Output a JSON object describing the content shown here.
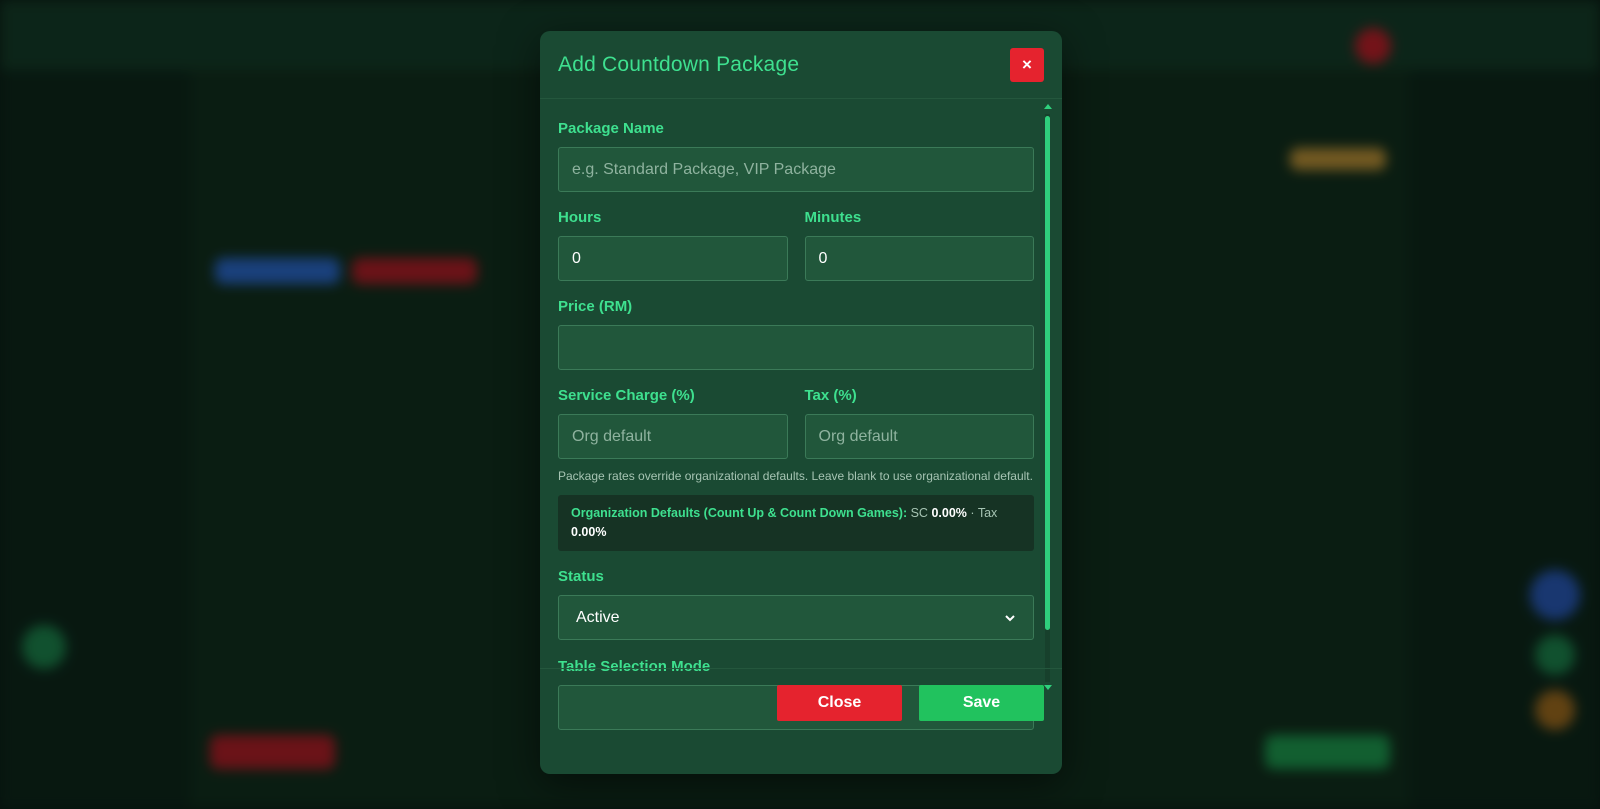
{
  "modal": {
    "title": "Add Countdown Package",
    "close_icon": "×",
    "fields": {
      "package_name": {
        "label": "Package Name",
        "placeholder": "e.g. Standard Package, VIP Package",
        "value": ""
      },
      "hours": {
        "label": "Hours",
        "value": "0"
      },
      "minutes": {
        "label": "Minutes",
        "value": "0"
      },
      "price": {
        "label": "Price (RM)",
        "value": ""
      },
      "service_charge": {
        "label": "Service Charge (%)",
        "placeholder": "Org default",
        "value": ""
      },
      "tax": {
        "label": "Tax (%)",
        "placeholder": "Org default",
        "value": ""
      },
      "status": {
        "label": "Status",
        "value": "Active"
      },
      "table_selection_mode": {
        "label": "Table Selection Mode"
      }
    },
    "hint": "Package rates override organizational defaults. Leave blank to use organizational default.",
    "defaults": {
      "label": "Organization Defaults (Count Up & Count Down Games):",
      "sc_prefix": "SC",
      "sc_value": "0.00%",
      "separator": "·",
      "tax_prefix": "Tax",
      "tax_value": "0.00%"
    },
    "footer": {
      "close_label": "Close",
      "save_label": "Save"
    }
  },
  "colors": {
    "accent": "#3ee08f",
    "danger": "#e5232e",
    "success": "#21c25e",
    "modal_bg": "#1a4a33"
  },
  "icons": {
    "close": "close-icon",
    "select": "chevron-down-icon",
    "scroll_up": "arrow-up-icon",
    "scroll_down": "arrow-down-icon"
  }
}
